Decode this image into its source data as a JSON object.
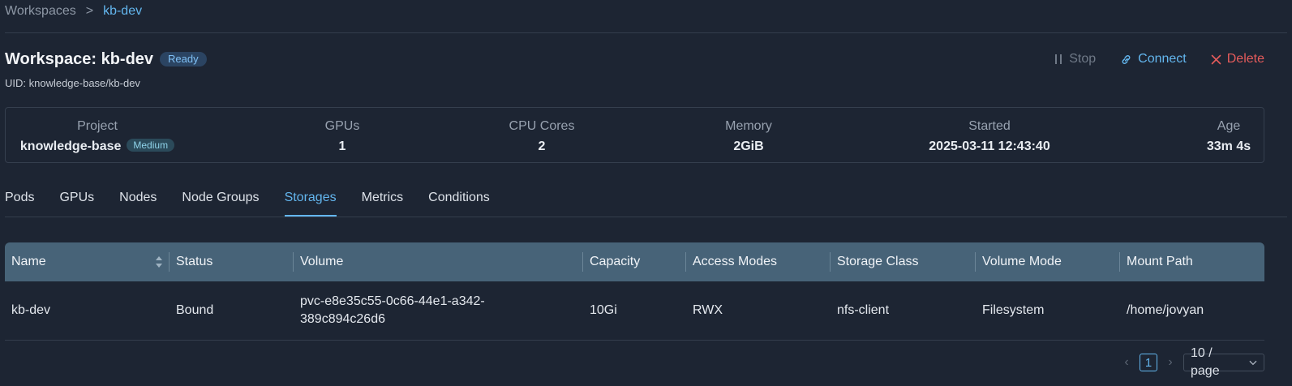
{
  "breadcrumb": {
    "parent": "Workspaces",
    "separator": ">",
    "current": "kb-dev"
  },
  "header": {
    "title": "Workspace: kb-dev",
    "status": "Ready",
    "uid": "UID: knowledge-base/kb-dev",
    "actions": {
      "stop": "Stop",
      "connect": "Connect",
      "delete": "Delete"
    }
  },
  "info": {
    "project_label": "Project",
    "project_value": "knowledge-base",
    "project_badge": "Medium",
    "gpus_label": "GPUs",
    "gpus_value": "1",
    "cpu_label": "CPU Cores",
    "cpu_value": "2",
    "memory_label": "Memory",
    "memory_value": "2GiB",
    "started_label": "Started",
    "started_value": "2025-03-11 12:43:40",
    "age_label": "Age",
    "age_value": "33m 4s"
  },
  "tabs": [
    {
      "label": "Pods"
    },
    {
      "label": "GPUs"
    },
    {
      "label": "Nodes"
    },
    {
      "label": "Node Groups"
    },
    {
      "label": "Storages",
      "active": true
    },
    {
      "label": "Metrics"
    },
    {
      "label": "Conditions"
    }
  ],
  "table": {
    "columns": [
      "Name",
      "Status",
      "Volume",
      "Capacity",
      "Access Modes",
      "Storage Class",
      "Volume Mode",
      "Mount Path"
    ],
    "rows": [
      {
        "name": "kb-dev",
        "status": "Bound",
        "volume_line1": "pvc-e8e35c55-0c66-44e1-a342-",
        "volume_line2": "389c894c26d6",
        "capacity": "10Gi",
        "access_modes": "RWX",
        "storage_class": "nfs-client",
        "volume_mode": "Filesystem",
        "mount_path": "/home/jovyan"
      }
    ]
  },
  "pagination": {
    "current_page": "1",
    "page_size": "10 / page"
  },
  "colors": {
    "accent": "#63b6ee",
    "danger": "#e45b5b",
    "background": "#1d2533",
    "table_header": "#476378"
  }
}
